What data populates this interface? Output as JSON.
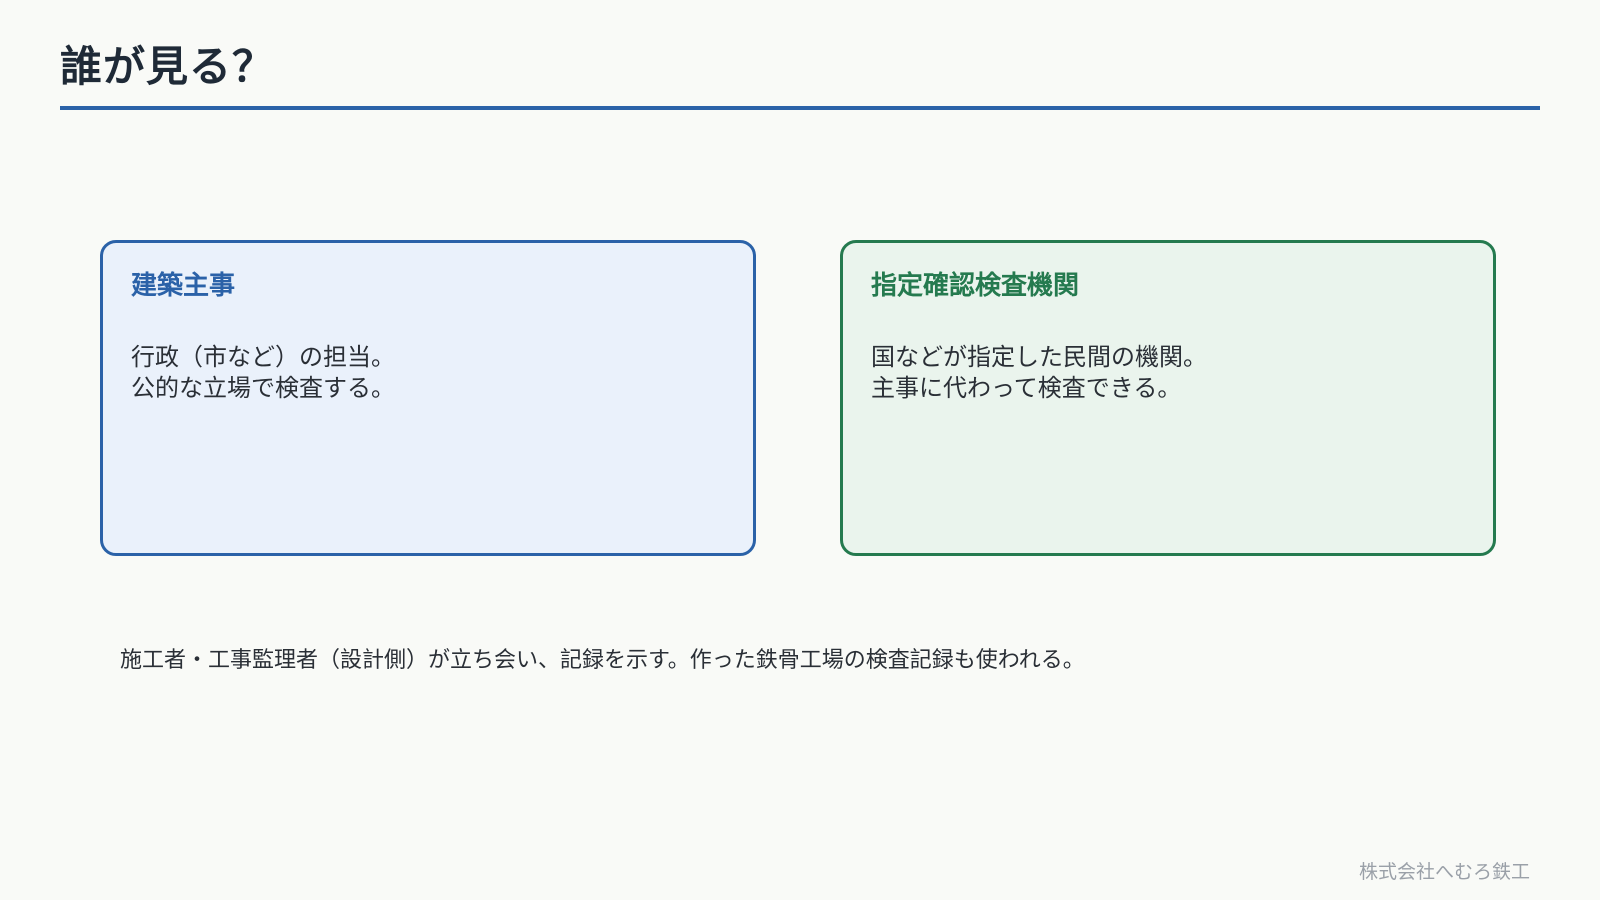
{
  "slide": {
    "title": "誰が見る？"
  },
  "cards": [
    {
      "title": "建築主事",
      "lines": [
        "行政（市など）の担当。",
        "公的な立場で検査する。"
      ],
      "accent_color": "#2b62a8",
      "background_color": "#eaf1fb"
    },
    {
      "title": "指定確認検査機関",
      "lines": [
        "国などが指定した民間の機関。",
        "主事に代わって検査できる。"
      ],
      "accent_color": "#257a4f",
      "background_color": "#eaf4ed"
    }
  ],
  "note": "施工者・工事監理者（設計側）が立ち会い、記録を示す。作った鉄骨工場の検査記録も使われる。",
  "footer": {
    "brand": "株式会社へむろ鉄工"
  }
}
